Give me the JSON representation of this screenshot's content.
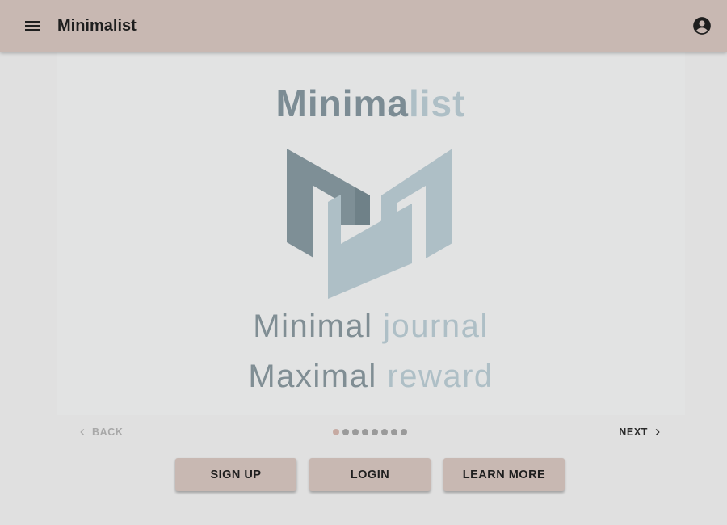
{
  "appbar": {
    "title": "Minimalist",
    "menu_icon": "hamburger-menu-icon",
    "account_icon": "account-circle-icon",
    "color": "#c8b8b2"
  },
  "slide": {
    "wordmark_dark": "Minima",
    "wordmark_light": "list",
    "logo": "minimalist-m-logo",
    "line1_dark": "Minimal",
    "line1_light": "journal",
    "line2_dark": "Maximal",
    "line2_light": "reward",
    "dark_color": "#7c8c94",
    "light_color": "#aebfc6"
  },
  "carousel": {
    "back_label": "BACK",
    "next_label": "NEXT",
    "page_count": 8,
    "current_page": 1,
    "active_dot_color": "#c6aaa2"
  },
  "actions": {
    "signup_label": "SIGN UP",
    "login_label": "LOGIN",
    "learn_more_label": "LEARN MORE"
  }
}
